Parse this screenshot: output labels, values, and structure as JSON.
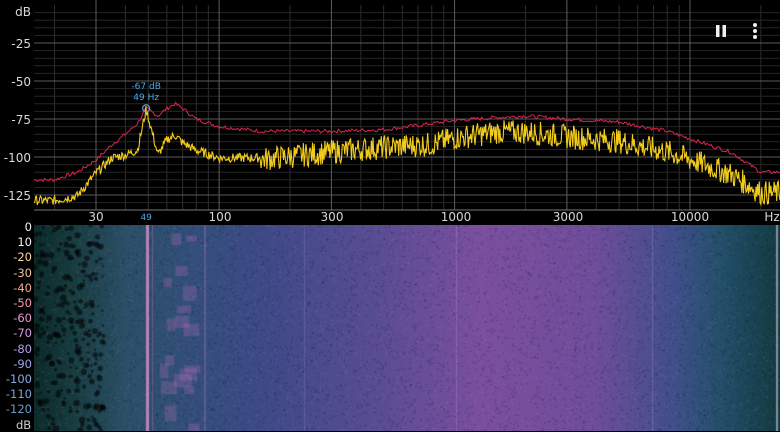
{
  "spectrum": {
    "y_unit": "dB",
    "x_unit": "Hz",
    "y_tick_labels": [
      "-25",
      "-50",
      "-75",
      "-100",
      "-125"
    ],
    "x_tick_labels": [
      "30",
      "100",
      "300",
      "1000",
      "3000",
      "10000"
    ],
    "peak": {
      "db_label": "-67 dB",
      "hz_label": "49 Hz",
      "axis_marker": "49"
    },
    "colors": {
      "current": "#f2cc1b",
      "max_hold": "#d8264e",
      "peak_marker": "#4aa8e8",
      "grid": "#555555"
    }
  },
  "controls": {
    "pause_icon": "pause-icon",
    "menu_icon": "more-vert-icon"
  },
  "spectrogram": {
    "y_tick_labels": [
      "0",
      "10",
      "-20",
      "-30",
      "-40",
      "-50",
      "-60",
      "-70",
      "-80",
      "-90",
      "-100",
      "-110",
      "-120"
    ],
    "y_unit": "dB",
    "label_colors": [
      "#f2f2f2",
      "#f2f2f2",
      "#f4d9a8",
      "#f0c0a0",
      "#f0a790",
      "#f09ab0",
      "#e59bd0",
      "#d39be0",
      "#b79de8",
      "#9ea6ea",
      "#8fa8e4",
      "#7aa3d6",
      "#6d9bc8"
    ]
  },
  "chart_data": {
    "type": "line",
    "x_scale": "log",
    "xlim": [
      20,
      20000
    ],
    "ylim": [
      -130,
      0
    ],
    "series": [
      {
        "color": "#d8264e",
        "x": [
          20,
          25,
          30,
          35,
          40,
          45,
          49,
          55,
          60,
          65,
          70,
          80,
          100,
          150,
          200,
          300,
          500,
          800,
          1000,
          1500,
          2000,
          3000,
          5000,
          8000,
          10000,
          15000,
          20000
        ],
        "y": [
          -115,
          -110,
          -102,
          -92,
          -85,
          -78,
          -68,
          -73,
          -68,
          -65,
          -68,
          -75,
          -80,
          -83,
          -83,
          -83,
          -82,
          -78,
          -76,
          -74,
          -73,
          -75,
          -77,
          -83,
          -88,
          -97,
          -110
        ]
      },
      {
        "color": "#f2cc1b",
        "x": [
          20,
          25,
          30,
          35,
          40,
          45,
          49,
          55,
          60,
          65,
          70,
          80,
          100,
          150,
          200,
          300,
          500,
          800,
          1000,
          1500,
          2000,
          3000,
          5000,
          8000,
          10000,
          15000,
          20000
        ],
        "y": [
          -128,
          -125,
          -110,
          -100,
          -98,
          -95,
          -68,
          -98,
          -88,
          -85,
          -90,
          -95,
          -100,
          -100,
          -98,
          -95,
          -92,
          -90,
          -86,
          -82,
          -82,
          -85,
          -88,
          -95,
          -100,
          -110,
          -122
        ]
      }
    ]
  }
}
